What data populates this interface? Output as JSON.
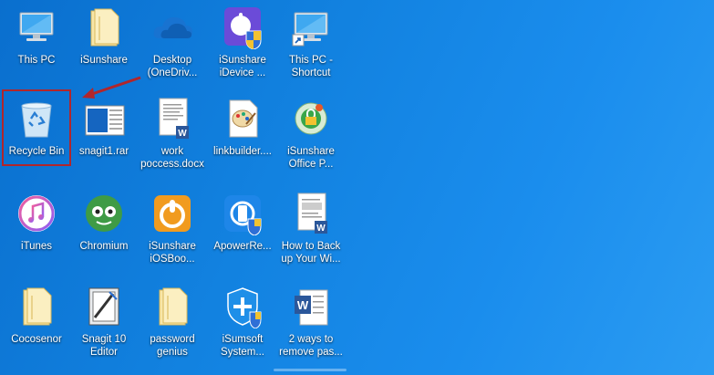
{
  "desktop": {
    "icons": [
      {
        "label": "This PC",
        "icon": "computer-icon"
      },
      {
        "label": "iSunshare",
        "icon": "folder-icon"
      },
      {
        "label": "Desktop (OneDriv...",
        "icon": "onedrive-cloud-icon"
      },
      {
        "label": "iSunshare iDevice ...",
        "icon": "isunshare-idevice-icon"
      },
      {
        "label": "This PC - Shortcut",
        "icon": "computer-shortcut-icon"
      },
      {
        "label": "Recycle Bin",
        "icon": "recycle-bin-icon"
      },
      {
        "label": "snagit1.rar",
        "icon": "rar-file-icon"
      },
      {
        "label": "work poccess.docx",
        "icon": "word-document-icon"
      },
      {
        "label": "linkbuilder....",
        "icon": "paint-file-icon"
      },
      {
        "label": "iSunshare Office P...",
        "icon": "isunshare-office-icon"
      },
      {
        "label": "iTunes",
        "icon": "itunes-icon"
      },
      {
        "label": "Chromium",
        "icon": "chromium-icon"
      },
      {
        "label": "iSunshare iOSBoo...",
        "icon": "isunshare-iosboot-icon"
      },
      {
        "label": "ApowerRe...",
        "icon": "apowerrescue-icon"
      },
      {
        "label": "How to Back up Your Wi...",
        "icon": "word-document-icon"
      },
      {
        "label": "Cocosenor",
        "icon": "folder-icon"
      },
      {
        "label": "Snagit 10 Editor",
        "icon": "snagit-editor-icon"
      },
      {
        "label": "password genius",
        "icon": "folder-icon"
      },
      {
        "label": "iSumsoft System...",
        "icon": "isumsoft-system-icon"
      },
      {
        "label": "2 ways to remove pas...",
        "icon": "word-document-icon"
      }
    ]
  },
  "annotation": {
    "highlight_color": "#b1262b",
    "highlighted_icon": "Recycle Bin"
  },
  "colors": {
    "desktop_bg": "#1282e0",
    "label_text": "#ffffff"
  }
}
